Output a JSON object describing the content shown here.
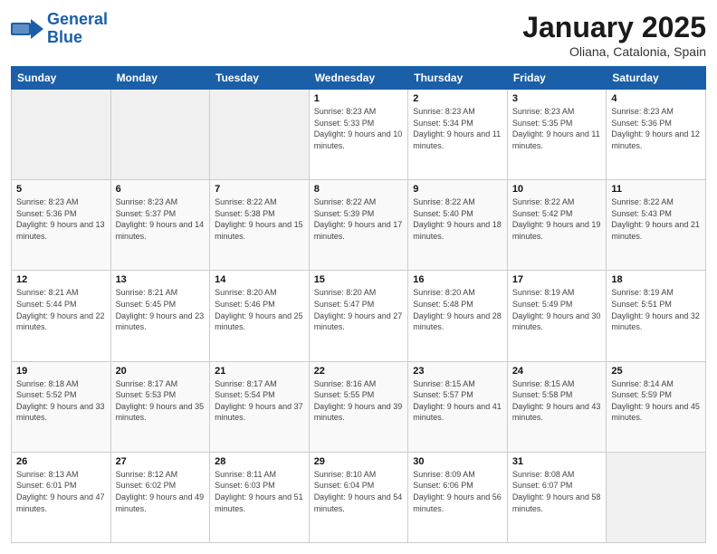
{
  "header": {
    "logo_line1": "General",
    "logo_line2": "Blue",
    "month": "January 2025",
    "location": "Oliana, Catalonia, Spain"
  },
  "days_of_week": [
    "Sunday",
    "Monday",
    "Tuesday",
    "Wednesday",
    "Thursday",
    "Friday",
    "Saturday"
  ],
  "weeks": [
    [
      {
        "day": "",
        "info": ""
      },
      {
        "day": "",
        "info": ""
      },
      {
        "day": "",
        "info": ""
      },
      {
        "day": "1",
        "info": "Sunrise: 8:23 AM\nSunset: 5:33 PM\nDaylight: 9 hours and 10 minutes."
      },
      {
        "day": "2",
        "info": "Sunrise: 8:23 AM\nSunset: 5:34 PM\nDaylight: 9 hours and 11 minutes."
      },
      {
        "day": "3",
        "info": "Sunrise: 8:23 AM\nSunset: 5:35 PM\nDaylight: 9 hours and 11 minutes."
      },
      {
        "day": "4",
        "info": "Sunrise: 8:23 AM\nSunset: 5:36 PM\nDaylight: 9 hours and 12 minutes."
      }
    ],
    [
      {
        "day": "5",
        "info": "Sunrise: 8:23 AM\nSunset: 5:36 PM\nDaylight: 9 hours and 13 minutes."
      },
      {
        "day": "6",
        "info": "Sunrise: 8:23 AM\nSunset: 5:37 PM\nDaylight: 9 hours and 14 minutes."
      },
      {
        "day": "7",
        "info": "Sunrise: 8:22 AM\nSunset: 5:38 PM\nDaylight: 9 hours and 15 minutes."
      },
      {
        "day": "8",
        "info": "Sunrise: 8:22 AM\nSunset: 5:39 PM\nDaylight: 9 hours and 17 minutes."
      },
      {
        "day": "9",
        "info": "Sunrise: 8:22 AM\nSunset: 5:40 PM\nDaylight: 9 hours and 18 minutes."
      },
      {
        "day": "10",
        "info": "Sunrise: 8:22 AM\nSunset: 5:42 PM\nDaylight: 9 hours and 19 minutes."
      },
      {
        "day": "11",
        "info": "Sunrise: 8:22 AM\nSunset: 5:43 PM\nDaylight: 9 hours and 21 minutes."
      }
    ],
    [
      {
        "day": "12",
        "info": "Sunrise: 8:21 AM\nSunset: 5:44 PM\nDaylight: 9 hours and 22 minutes."
      },
      {
        "day": "13",
        "info": "Sunrise: 8:21 AM\nSunset: 5:45 PM\nDaylight: 9 hours and 23 minutes."
      },
      {
        "day": "14",
        "info": "Sunrise: 8:20 AM\nSunset: 5:46 PM\nDaylight: 9 hours and 25 minutes."
      },
      {
        "day": "15",
        "info": "Sunrise: 8:20 AM\nSunset: 5:47 PM\nDaylight: 9 hours and 27 minutes."
      },
      {
        "day": "16",
        "info": "Sunrise: 8:20 AM\nSunset: 5:48 PM\nDaylight: 9 hours and 28 minutes."
      },
      {
        "day": "17",
        "info": "Sunrise: 8:19 AM\nSunset: 5:49 PM\nDaylight: 9 hours and 30 minutes."
      },
      {
        "day": "18",
        "info": "Sunrise: 8:19 AM\nSunset: 5:51 PM\nDaylight: 9 hours and 32 minutes."
      }
    ],
    [
      {
        "day": "19",
        "info": "Sunrise: 8:18 AM\nSunset: 5:52 PM\nDaylight: 9 hours and 33 minutes."
      },
      {
        "day": "20",
        "info": "Sunrise: 8:17 AM\nSunset: 5:53 PM\nDaylight: 9 hours and 35 minutes."
      },
      {
        "day": "21",
        "info": "Sunrise: 8:17 AM\nSunset: 5:54 PM\nDaylight: 9 hours and 37 minutes."
      },
      {
        "day": "22",
        "info": "Sunrise: 8:16 AM\nSunset: 5:55 PM\nDaylight: 9 hours and 39 minutes."
      },
      {
        "day": "23",
        "info": "Sunrise: 8:15 AM\nSunset: 5:57 PM\nDaylight: 9 hours and 41 minutes."
      },
      {
        "day": "24",
        "info": "Sunrise: 8:15 AM\nSunset: 5:58 PM\nDaylight: 9 hours and 43 minutes."
      },
      {
        "day": "25",
        "info": "Sunrise: 8:14 AM\nSunset: 5:59 PM\nDaylight: 9 hours and 45 minutes."
      }
    ],
    [
      {
        "day": "26",
        "info": "Sunrise: 8:13 AM\nSunset: 6:01 PM\nDaylight: 9 hours and 47 minutes."
      },
      {
        "day": "27",
        "info": "Sunrise: 8:12 AM\nSunset: 6:02 PM\nDaylight: 9 hours and 49 minutes."
      },
      {
        "day": "28",
        "info": "Sunrise: 8:11 AM\nSunset: 6:03 PM\nDaylight: 9 hours and 51 minutes."
      },
      {
        "day": "29",
        "info": "Sunrise: 8:10 AM\nSunset: 6:04 PM\nDaylight: 9 hours and 54 minutes."
      },
      {
        "day": "30",
        "info": "Sunrise: 8:09 AM\nSunset: 6:06 PM\nDaylight: 9 hours and 56 minutes."
      },
      {
        "day": "31",
        "info": "Sunrise: 8:08 AM\nSunset: 6:07 PM\nDaylight: 9 hours and 58 minutes."
      },
      {
        "day": "",
        "info": ""
      }
    ]
  ]
}
